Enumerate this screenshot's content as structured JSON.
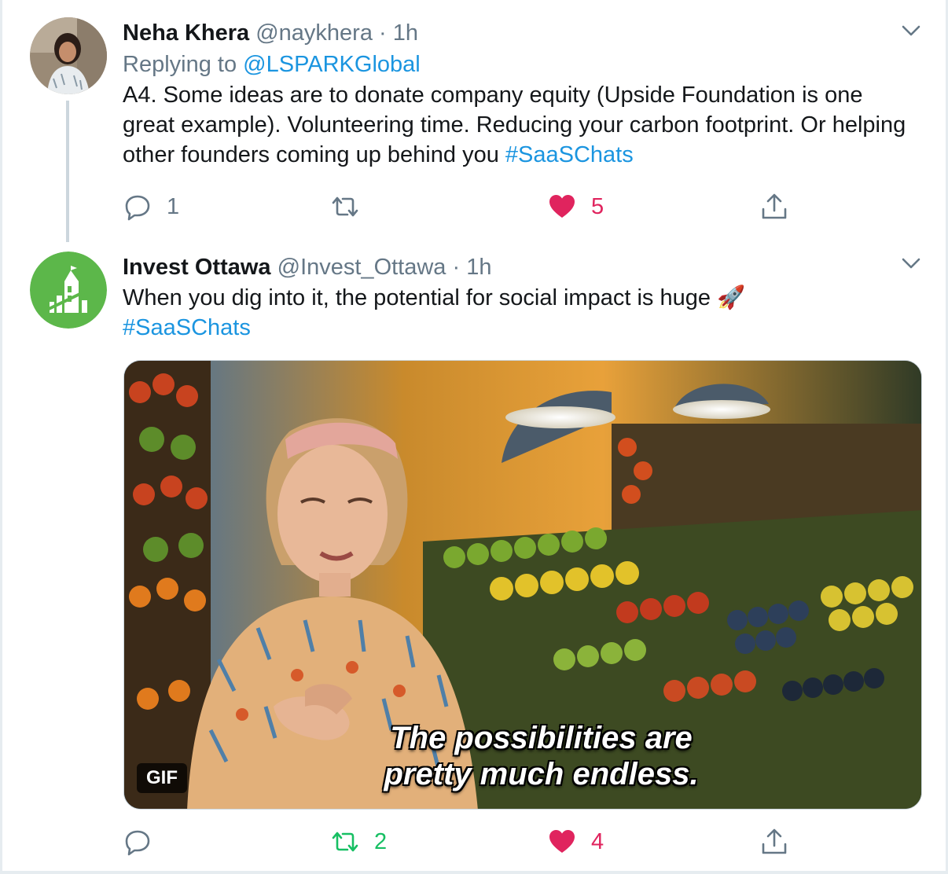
{
  "tweets": [
    {
      "name": "Neha Khera",
      "handle": "@naykhera",
      "separator": "·",
      "time": "1h",
      "replying_prefix": "Replying to",
      "replying_to": "@LSPARKGlobal",
      "text": "A4. Some ideas are to donate company equity (Upside Foundation is one great example). Volunteering time. Reducing your carbon footprint. Or helping other founders coming up behind you",
      "hashtag": "#SaaSChats",
      "reply_count": "1",
      "retweet_count": "",
      "like_count": "5"
    },
    {
      "name": "Invest Ottawa",
      "handle": "@Invest_Ottawa",
      "separator": "·",
      "time": "1h",
      "text": "When you dig into it, the potential for social impact is huge",
      "emoji": "🚀",
      "hashtag": "#SaaSChats",
      "media": {
        "caption_line1": "The possibilities are",
        "caption_line2": "pretty much endless.",
        "badge": "GIF"
      },
      "reply_count": "",
      "retweet_count": "2",
      "like_count": "4"
    }
  ],
  "colors": {
    "link": "#1b95e0",
    "like": "#e0245e",
    "retweet_active": "#17bf63",
    "muted": "#657786",
    "invest_ottawa_brand": "#5cb74a"
  },
  "icons": {
    "reply": "reply-icon",
    "retweet": "retweet-icon",
    "like": "heart-icon",
    "share": "share-icon",
    "more": "chevron-down-icon"
  }
}
